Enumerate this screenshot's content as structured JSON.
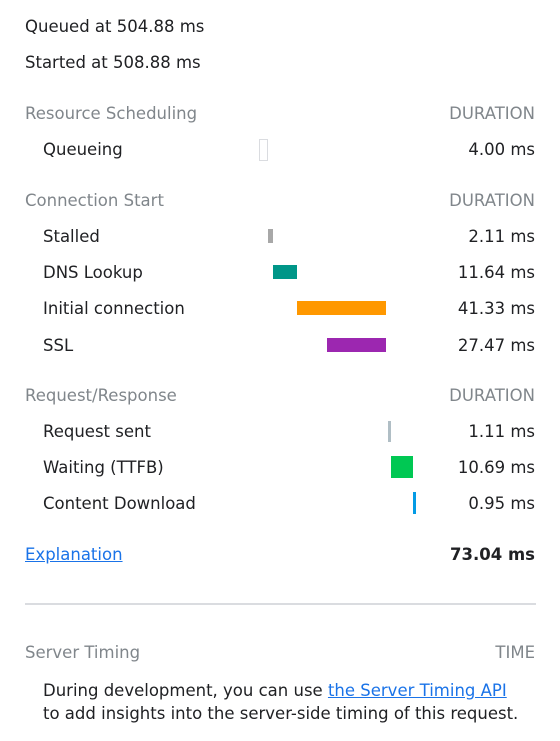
{
  "queued": "Queued at 504.88 ms",
  "started": "Started at 508.88 ms",
  "sections": {
    "resource_scheduling": {
      "title": "Resource Scheduling",
      "header": "DURATION",
      "rows": [
        {
          "label": "Queueing",
          "value": "4.00 ms"
        }
      ]
    },
    "connection_start": {
      "title": "Connection Start",
      "header": "DURATION",
      "rows": [
        {
          "label": "Stalled",
          "value": "2.11 ms"
        },
        {
          "label": "DNS Lookup",
          "value": "11.64 ms"
        },
        {
          "label": "Initial connection",
          "value": "41.33 ms"
        },
        {
          "label": "SSL",
          "value": "27.47 ms"
        }
      ]
    },
    "request_response": {
      "title": "Request/Response",
      "header": "DURATION",
      "rows": [
        {
          "label": "Request sent",
          "value": "1.11 ms"
        },
        {
          "label": "Waiting (TTFB)",
          "value": "10.69 ms"
        },
        {
          "label": "Content Download",
          "value": "0.95 ms"
        }
      ]
    }
  },
  "explanation_link": "Explanation",
  "total": "73.04 ms",
  "server_timing": {
    "title": "Server Timing",
    "header": "TIME",
    "desc_prefix": "During development, you can use ",
    "desc_link": "the Server Timing API",
    "desc_suffix": " to add insights into the server-side timing of this request."
  },
  "colors": {
    "queueing": "#ffffff",
    "stalled": "#a8a8a8",
    "dns": "#009688",
    "initial_connection": "#ff9800",
    "ssl": "#9c27b0",
    "request_sent": "#b0bec5",
    "waiting": "#00c853",
    "content_download": "#039be5"
  }
}
